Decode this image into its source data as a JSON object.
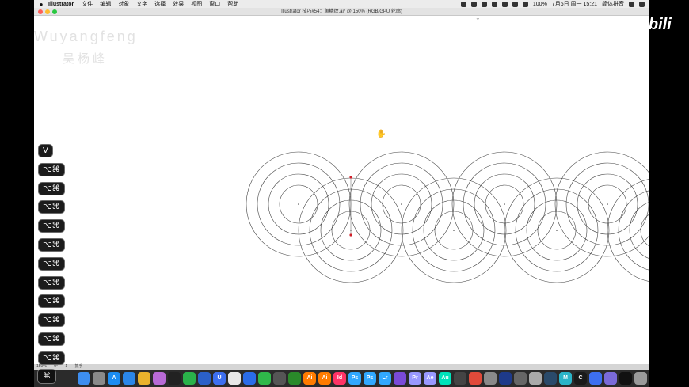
{
  "menubar": {
    "apple": "",
    "app_name": "Illustrator",
    "items": [
      "文件",
      "编辑",
      "对象",
      "文字",
      "选择",
      "效果",
      "视图",
      "窗口",
      "帮助"
    ],
    "battery": "100%",
    "datetime": "7月6日 周一  15:21",
    "input_method": "简体拼音"
  },
  "titlebar": {
    "title": "Illustrator 技巧#54：鱼鳞纹.ai* @ 150% (RGB/GPU 轮廓)"
  },
  "watermark": {
    "en": "Wuyangfeng",
    "cn": "吴杨峰"
  },
  "shortcut_keys": [
    "V",
    "⌥⌘",
    "⌥⌘",
    "⌥⌘",
    "⌥⌘",
    "⌥⌘",
    "⌥⌘",
    "⌥⌘",
    "⌥⌘",
    "⌥⌘",
    "⌥⌘",
    "⌥⌘"
  ],
  "current_keypress": "⌘",
  "statusbar": {
    "zoom": "150%",
    "angle": "0°",
    "artboard": "1",
    "tool": "抓手"
  },
  "dock": {
    "apps": [
      {
        "icon": "finder-icon",
        "label": "",
        "color": "#3d8ef0"
      },
      {
        "icon": "launchpad-icon",
        "label": "",
        "color": "#8a8a8a"
      },
      {
        "icon": "appstore-icon",
        "label": "A",
        "color": "#1b8cf2"
      },
      {
        "icon": "safari-icon",
        "label": "",
        "color": "#2b86e8"
      },
      {
        "icon": "chrome-icon",
        "label": "",
        "color": "#e9b22c"
      },
      {
        "icon": "photos-icon",
        "label": "",
        "color": "#b86ad6"
      },
      {
        "icon": "qq-icon",
        "label": "",
        "color": "#222"
      },
      {
        "icon": "wechat-icon",
        "label": "",
        "color": "#2ab24a"
      },
      {
        "icon": "word-icon",
        "label": "",
        "color": "#2b60c8"
      },
      {
        "icon": "u-icon",
        "label": "U",
        "color": "#3d6ff0"
      },
      {
        "icon": "baidu-icon",
        "label": "",
        "color": "#e8e8e8"
      },
      {
        "icon": "xunlei-icon",
        "label": "",
        "color": "#2a6ce8"
      },
      {
        "icon": "evernote-icon",
        "label": "",
        "color": "#2fb94a"
      },
      {
        "icon": "script-icon",
        "label": "",
        "color": "#555"
      },
      {
        "icon": "xbox-icon",
        "label": "",
        "color": "#2a8a2a"
      },
      {
        "icon": "ai-icon",
        "label": "Ai",
        "color": "#ff7c00"
      },
      {
        "icon": "ai2-icon",
        "label": "Ai",
        "color": "#ff7c00"
      },
      {
        "icon": "id-icon",
        "label": "Id",
        "color": "#ff3366"
      },
      {
        "icon": "ps-icon",
        "label": "Ps",
        "color": "#31a8ff"
      },
      {
        "icon": "ps2-icon",
        "label": "Ps",
        "color": "#31a8ff"
      },
      {
        "icon": "lr-icon",
        "label": "Lr",
        "color": "#31a8ff"
      },
      {
        "icon": "finalcut-icon",
        "label": "",
        "color": "#7a4ad8"
      },
      {
        "icon": "pr-icon",
        "label": "Pr",
        "color": "#9999ff"
      },
      {
        "icon": "ae-icon",
        "label": "Ae",
        "color": "#9999ff"
      },
      {
        "icon": "au-icon",
        "label": "Au",
        "color": "#00e4bb"
      },
      {
        "icon": "davinci-icon",
        "label": "",
        "color": "#444"
      },
      {
        "icon": "compressor-icon",
        "label": "",
        "color": "#e04a3a"
      },
      {
        "icon": "settings-icon",
        "label": "",
        "color": "#8a8a8a"
      },
      {
        "icon": "cinema4d-icon",
        "label": "",
        "color": "#1e3a8a"
      },
      {
        "icon": "media-encoder-icon",
        "label": "",
        "color": "#666"
      },
      {
        "icon": "zbrush-icon",
        "label": "",
        "color": "#aaa"
      },
      {
        "icon": "blender-icon",
        "label": "",
        "color": "#2a4a6a"
      },
      {
        "icon": "m-icon",
        "label": "M",
        "color": "#2ab4c8"
      },
      {
        "icon": "c-icon",
        "label": "C",
        "color": "#1a1a1a"
      },
      {
        "icon": "network-icon",
        "label": "",
        "color": "#3d6ff0"
      },
      {
        "icon": "preview-icon",
        "label": "",
        "color": "#7a6ad8"
      },
      {
        "icon": "terminal-icon",
        "label": "",
        "color": "#111"
      },
      {
        "icon": "trash-icon",
        "label": "",
        "color": "#9a9a9a"
      }
    ]
  },
  "bilibili_logo": "bilibili"
}
